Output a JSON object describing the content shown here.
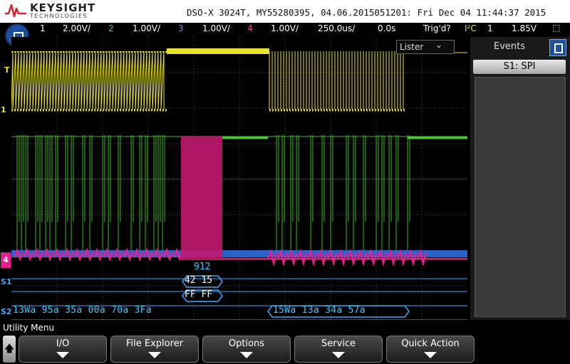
{
  "brand": {
    "name": "KEYSIGHT",
    "sub": "TECHNOLOGIES"
  },
  "device_info": "DSO-X 3024T, MY55280395, 04.06.2015051201: Fri Dec 04 11:44:37 2015",
  "settings": {
    "ch1_num": "1",
    "ch1_scale": "2.00V/",
    "ch2_num": "2",
    "ch2_scale": "1.00V/",
    "ch3_num": "3",
    "ch3_scale": "1.00V/",
    "ch4_num": "4",
    "ch4_scale": "1.00V/",
    "timebase": "250.0us/",
    "delay": "0.0s",
    "trigger_status": "Trig'd?",
    "trigger_mode": "I²C",
    "trigger_source": "1",
    "trigger_level": "1.85V"
  },
  "colors": {
    "ch1": "#e8e22e",
    "ch2": "#4bd12d",
    "ch3": "#2f6fe0",
    "ch4": "#e81e90",
    "decode": "#3aa8ff",
    "decode_text": "#40c8ff"
  },
  "lister": {
    "label": "Lister",
    "chevron": "⌄"
  },
  "events_panel": {
    "title": "Events",
    "source_button": "S1: SPI"
  },
  "markers": {
    "trigger": "T",
    "ch1": "1",
    "ch4": "4",
    "s1": "S1",
    "s2": "S2"
  },
  "decode": {
    "counter": "912",
    "s1_row1": "42 15",
    "s1_row2": "FF FF",
    "s2_packets": [
      {
        "text": "13Wa 95a 35a 00a 70a 3Fa"
      },
      {
        "text": "15Wa 13a 34a 57a"
      }
    ]
  },
  "utility": {
    "menu_title": "Utility Menu",
    "softkeys": [
      {
        "label": "I/O"
      },
      {
        "label": "File Explorer"
      },
      {
        "label": "Options"
      },
      {
        "label": "Service"
      },
      {
        "label": "Quick Action"
      }
    ]
  }
}
